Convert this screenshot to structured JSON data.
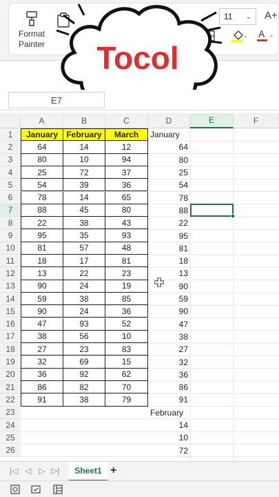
{
  "ribbon": {
    "format_painter_label": "Format Painter",
    "font_size": "11",
    "grow_font_label": "A+"
  },
  "overlay": {
    "brand_text": "Tocol"
  },
  "name_box": "E7",
  "columns": [
    "A",
    "B",
    "C",
    "D",
    "E",
    "F"
  ],
  "selected_column": "E",
  "selected_row": 7,
  "table": {
    "headers": [
      "January",
      "February",
      "March"
    ],
    "rows": [
      [
        64,
        14,
        12
      ],
      [
        80,
        10,
        94
      ],
      [
        25,
        72,
        37
      ],
      [
        54,
        39,
        36
      ],
      [
        78,
        14,
        65
      ],
      [
        88,
        45,
        80
      ],
      [
        22,
        38,
        43
      ],
      [
        95,
        35,
        93
      ],
      [
        81,
        57,
        48
      ],
      [
        18,
        17,
        81
      ],
      [
        13,
        22,
        23
      ],
      [
        90,
        24,
        19
      ],
      [
        59,
        38,
        85
      ],
      [
        90,
        24,
        36
      ],
      [
        47,
        93,
        52
      ],
      [
        38,
        56,
        10
      ],
      [
        27,
        23,
        83
      ],
      [
        32,
        69,
        15
      ],
      [
        36,
        92,
        62
      ],
      [
        86,
        82,
        70
      ],
      [
        91,
        38,
        79
      ]
    ]
  },
  "column_d": [
    "January",
    "64",
    "80",
    "25",
    "54",
    "78",
    "88",
    "22",
    "95",
    "81",
    "18",
    "13",
    "90",
    "59",
    "90",
    "47",
    "38",
    "27",
    "32",
    "36",
    "86",
    "91",
    "February",
    "14",
    "10",
    "72"
  ],
  "tabs": {
    "sheet_name": "Sheet1",
    "add_label": "+"
  },
  "colors": {
    "accent": "#217346",
    "header_fill": "#ffff00",
    "brand_red": "#e02d2d"
  }
}
